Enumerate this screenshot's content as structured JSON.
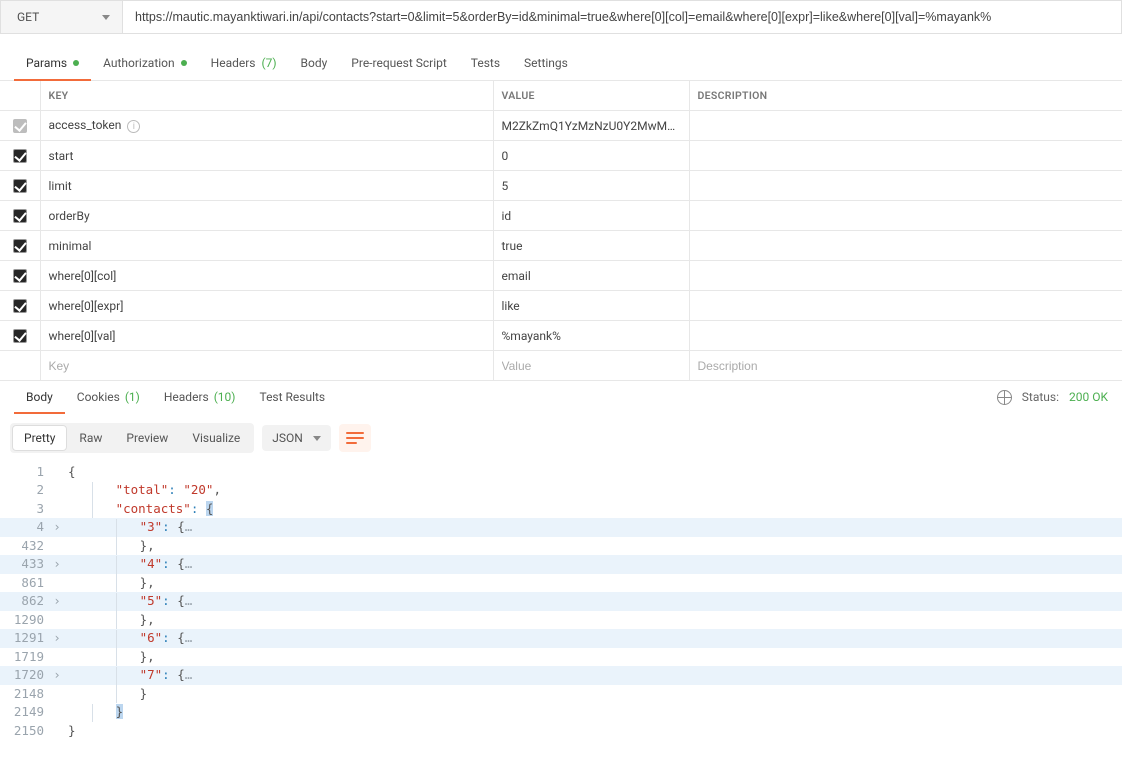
{
  "request": {
    "method": "GET",
    "url": "https://mautic.mayanktiwari.in/api/contacts?start=0&limit=5&orderBy=id&minimal=true&where[0][col]=email&where[0][expr]=like&where[0][val]=%mayank%"
  },
  "tabs": {
    "params": "Params",
    "authorization": "Authorization",
    "headers": "Headers",
    "headers_count": "(7)",
    "body": "Body",
    "prerequest": "Pre-request Script",
    "tests": "Tests",
    "settings": "Settings"
  },
  "params_header": {
    "key": "KEY",
    "value": "VALUE",
    "description": "DESCRIPTION"
  },
  "params": [
    {
      "checked": true,
      "greyed": true,
      "key": "access_token",
      "info": true,
      "value": "M2ZkZmQ1YzMzNzU0Y2MwM…",
      "description": ""
    },
    {
      "checked": true,
      "key": "start",
      "value": "0",
      "description": ""
    },
    {
      "checked": true,
      "key": "limit",
      "value": "5",
      "description": ""
    },
    {
      "checked": true,
      "key": "orderBy",
      "value": "id",
      "description": ""
    },
    {
      "checked": true,
      "key": "minimal",
      "value": "true",
      "description": ""
    },
    {
      "checked": true,
      "key": "where[0][col]",
      "value": "email",
      "description": ""
    },
    {
      "checked": true,
      "key": "where[0][expr]",
      "value": "like",
      "description": ""
    },
    {
      "checked": true,
      "key": "where[0][val]",
      "value": "%mayank%",
      "description": ""
    }
  ],
  "params_placeholder": {
    "key": "Key",
    "value": "Value",
    "description": "Description"
  },
  "response_tabs": {
    "body": "Body",
    "cookies": "Cookies",
    "cookies_count": "(1)",
    "headers": "Headers",
    "headers_count": "(10)",
    "testresults": "Test Results"
  },
  "status": {
    "label": "Status:",
    "value": "200 OK"
  },
  "format": {
    "pretty": "Pretty",
    "raw": "Raw",
    "preview": "Preview",
    "visualize": "Visualize",
    "type": "JSON"
  },
  "json": {
    "lines": [
      {
        "n": "1",
        "fold": "",
        "hl": false,
        "tokens": [
          [
            "brace",
            "{"
          ]
        ]
      },
      {
        "n": "2",
        "fold": "",
        "hl": false,
        "tokens": [
          [
            "ind1",
            ""
          ],
          [
            "str",
            "\"total\""
          ],
          [
            "punc",
            ":"
          ],
          [
            "sp",
            " "
          ],
          [
            "str",
            "\"20\""
          ],
          [
            "brace",
            ","
          ]
        ]
      },
      {
        "n": "3",
        "fold": "",
        "hl": false,
        "tokens": [
          [
            "ind1",
            ""
          ],
          [
            "str",
            "\"contacts\""
          ],
          [
            "punc",
            ":"
          ],
          [
            "sp",
            " "
          ],
          [
            "sel",
            "{"
          ]
        ]
      },
      {
        "n": "4",
        "fold": ">",
        "hl": true,
        "tokens": [
          [
            "ind2",
            ""
          ],
          [
            "str",
            "\"3\""
          ],
          [
            "punc",
            ":"
          ],
          [
            "sp",
            " "
          ],
          [
            "brace",
            "{"
          ],
          [
            "ell",
            "…"
          ]
        ]
      },
      {
        "n": "432",
        "fold": "",
        "hl": false,
        "tokens": [
          [
            "ind2",
            ""
          ],
          [
            "brace",
            "},"
          ]
        ]
      },
      {
        "n": "433",
        "fold": ">",
        "hl": true,
        "tokens": [
          [
            "ind2",
            ""
          ],
          [
            "str",
            "\"4\""
          ],
          [
            "punc",
            ":"
          ],
          [
            "sp",
            " "
          ],
          [
            "brace",
            "{"
          ],
          [
            "ell",
            "…"
          ]
        ]
      },
      {
        "n": "861",
        "fold": "",
        "hl": false,
        "tokens": [
          [
            "ind2",
            ""
          ],
          [
            "brace",
            "},"
          ]
        ]
      },
      {
        "n": "862",
        "fold": ">",
        "hl": true,
        "tokens": [
          [
            "ind2",
            ""
          ],
          [
            "str",
            "\"5\""
          ],
          [
            "punc",
            ":"
          ],
          [
            "sp",
            " "
          ],
          [
            "brace",
            "{"
          ],
          [
            "ell",
            "…"
          ]
        ]
      },
      {
        "n": "1290",
        "fold": "",
        "hl": false,
        "tokens": [
          [
            "ind2",
            ""
          ],
          [
            "brace",
            "},"
          ]
        ]
      },
      {
        "n": "1291",
        "fold": ">",
        "hl": true,
        "tokens": [
          [
            "ind2",
            ""
          ],
          [
            "str",
            "\"6\""
          ],
          [
            "punc",
            ":"
          ],
          [
            "sp",
            " "
          ],
          [
            "brace",
            "{"
          ],
          [
            "ell",
            "…"
          ]
        ]
      },
      {
        "n": "1719",
        "fold": "",
        "hl": false,
        "tokens": [
          [
            "ind2",
            ""
          ],
          [
            "brace",
            "},"
          ]
        ]
      },
      {
        "n": "1720",
        "fold": ">",
        "hl": true,
        "tokens": [
          [
            "ind2",
            ""
          ],
          [
            "str",
            "\"7\""
          ],
          [
            "punc",
            ":"
          ],
          [
            "sp",
            " "
          ],
          [
            "brace",
            "{"
          ],
          [
            "ell",
            "…"
          ]
        ]
      },
      {
        "n": "2148",
        "fold": "",
        "hl": false,
        "tokens": [
          [
            "ind2",
            ""
          ],
          [
            "brace",
            "}"
          ]
        ]
      },
      {
        "n": "2149",
        "fold": "",
        "hl": false,
        "tokens": [
          [
            "ind1",
            ""
          ],
          [
            "sel",
            "}"
          ]
        ]
      },
      {
        "n": "2150",
        "fold": "",
        "hl": false,
        "tokens": [
          [
            "brace",
            "}"
          ]
        ]
      }
    ]
  }
}
